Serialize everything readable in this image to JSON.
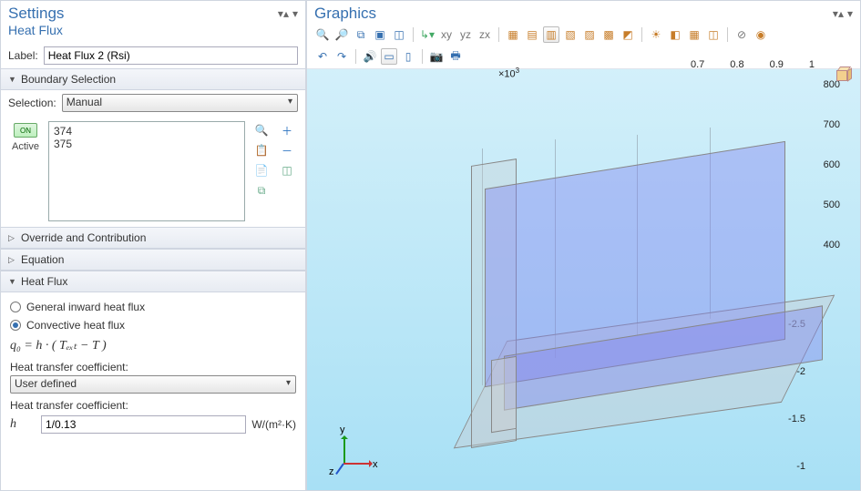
{
  "settings": {
    "title": "Settings",
    "subtitle": "Heat Flux",
    "label_lbl": "Label:",
    "label_val": "Heat Flux 2 (Rsi)",
    "sections": {
      "boundary": "Boundary Selection",
      "override": "Override and Contribution",
      "equation": "Equation",
      "heatflux": "Heat Flux"
    },
    "selection_lbl": "Selection:",
    "selection_val": "Manual",
    "active_lbl": "Active",
    "on_chip": "ON",
    "list": [
      "374",
      "375"
    ],
    "radio_general": "General inward heat flux",
    "radio_convective": "Convective heat flux",
    "equation_tex": "q₀ = h · ( Tₑₓₜ − T )",
    "htc_lbl": "Heat transfer coefficient:",
    "htc_type": "User defined",
    "h_sym": "h",
    "h_val": "1/0.13",
    "h_unit": "W/(m²·K)"
  },
  "graphics": {
    "title": "Graphics",
    "axis": {
      "x": "x",
      "y": "y",
      "z": "z"
    },
    "sci": "×10",
    "sci_exp": "3",
    "ticks_top": [
      "0.7",
      "0.8",
      "0.9",
      "1"
    ],
    "ticks_right": [
      "800",
      "700",
      "600",
      "500",
      "400"
    ],
    "ticks_front": [
      "-2.5",
      "-2",
      "-1.5",
      "-1"
    ]
  }
}
